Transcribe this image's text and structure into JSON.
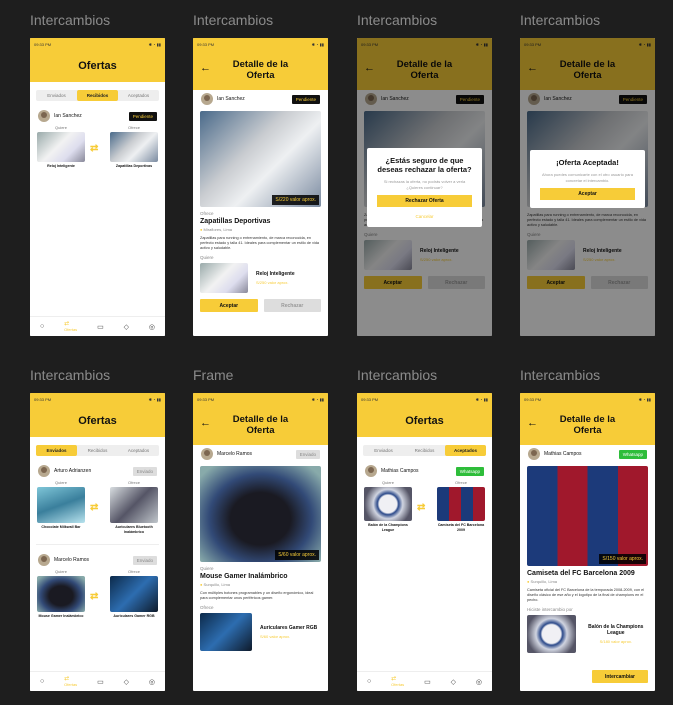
{
  "labels": [
    "Intercambios",
    "Intercambios",
    "Intercambios",
    "Intercambios",
    "Intercambios",
    "Frame",
    "Intercambios",
    "Intercambios"
  ],
  "status_time": "09:33 PM",
  "common": {
    "ofertas": "Ofertas",
    "detalle": "Detalle de la Oferta",
    "tab_enviados": "Enviados",
    "tab_recibidos": "Recibidos",
    "tab_aceptados": "Aceptados",
    "quiere": "Quiere",
    "ofrece": "Ofrece",
    "aceptar": "Aceptar",
    "rechazar": "Rechazar",
    "nav_ofertas": "Ofertas"
  },
  "s1": {
    "user": "Ian Sanchez",
    "status": "Pendiente",
    "want": "Reloj Inteligente",
    "offer": "Zapatillas Deportivas"
  },
  "s2": {
    "user": "Ian Sanchez",
    "status": "Pendiente",
    "price": "S/220 valor aprox.",
    "title": "Zapatillas Deportivas",
    "loc": "Miraflores, Lima",
    "desc": "Zapatillas para running o entrenamiento, de marca reconocida, en perfecto estado y talla 41. Ideales para complementar un estilo de vida activo y saludable.",
    "want": "Reloj Inteligente",
    "want_price": "S/250 valor aprox."
  },
  "s3": {
    "title": "¿Estás seguro de que deseas rechazar la oferta?",
    "text": "Si rechazas la oferta, no podrás volver a verla ¿Quieres continuar?",
    "primary": "Rechazar Oferta",
    "link": "Cancelar"
  },
  "s4": {
    "title": "¡Oferta Aceptada!",
    "text": "Ahora puedes comunicarte con el otro usuario para concretar el intercambio.",
    "primary": "Aceptar"
  },
  "s5": {
    "r1_user": "Arturo Adrianzen",
    "r1_status": "Enviado",
    "r1_want": "Chocolate Milkwall Bar",
    "r1_offer": "Auriculares Bluetooth Inalámbrico",
    "r2_user": "Marcelo Ramos",
    "r2_status": "Enviado",
    "r2_want": "Mouse Gamer Inalámbrico",
    "r2_offer": "Auriculares Gamer RGB"
  },
  "s6": {
    "user": "Marcelo Ramos",
    "status": "Enviado",
    "price": "S/60 valor aprox.",
    "title": "Mouse Gamer Inalámbrico",
    "loc": "Surquillo, Lima",
    "desc": "Con múltiples botones programables y un diseño ergonómico, ideal para complementar unos periféricos gamer.",
    "offer": "Auriculares Gamer RGB",
    "offer_price": "S/60 valor aprox."
  },
  "s7": {
    "user": "Mathias Campos",
    "status": "Whatsapp",
    "want": "Balón de la Champions League",
    "offer": "Camiseta del FC Barcelona 2009"
  },
  "s8": {
    "user": "Mathias Campos",
    "status": "Whatsapp",
    "price": "S/150 valor aprox.",
    "title": "Camiseta del FC Barcelona 2009",
    "loc": "Surquillo, Lima",
    "desc": "Camiseta oficial del FC Barcelona de la temporada 2008-2009, con el diseño clásico de ese año y el logotipo de la final de champions en el pecho.",
    "want_label": "Hiciste intercambio por",
    "want": "Balón de la Champions League",
    "want_price": "S/180 valor aprox.",
    "button": "Intercambiar"
  }
}
